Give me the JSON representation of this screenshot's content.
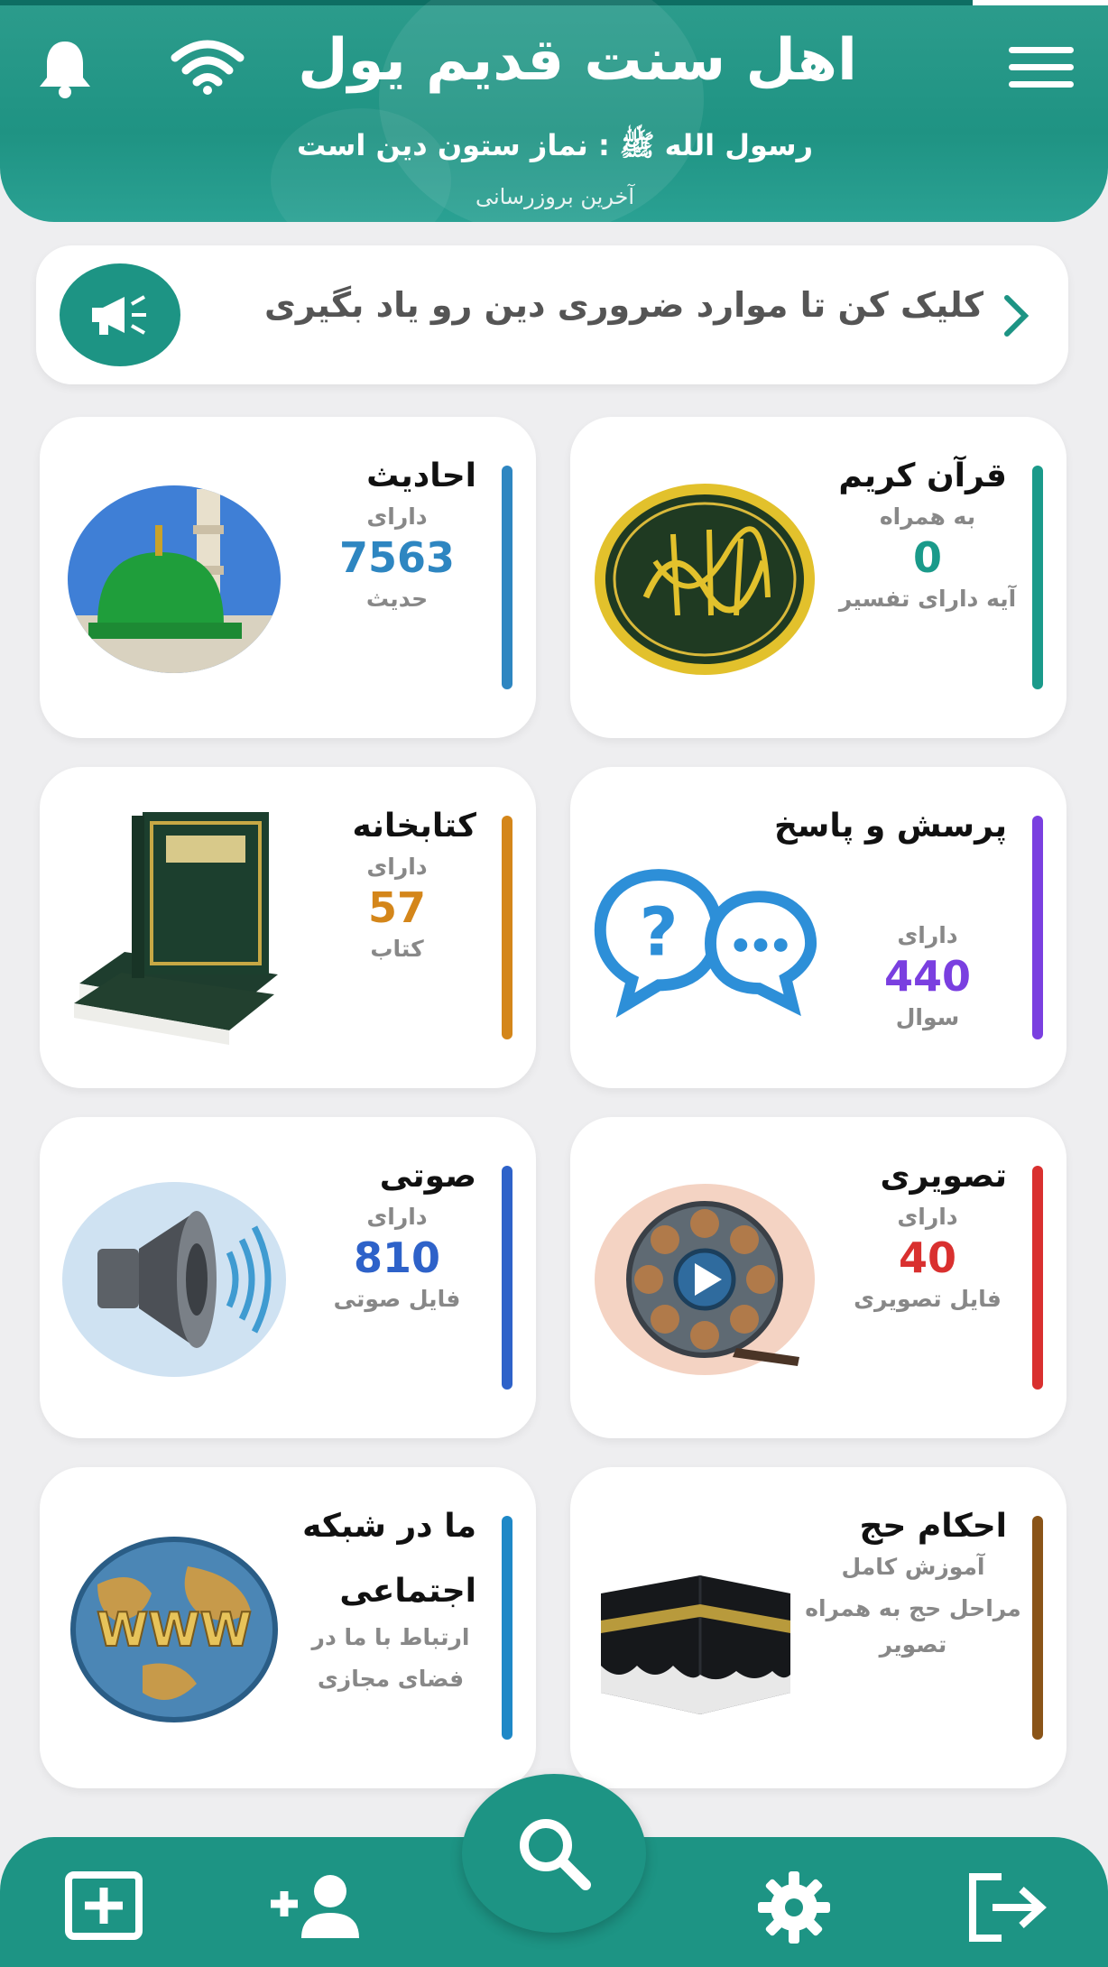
{
  "header": {
    "title": "اهل سنت قدیم یول",
    "subtitle": "رسول الله ﷺ : نماز ستون دین است",
    "update_text": "آخرین بروزرسانی"
  },
  "banner": {
    "text": "کلیک کن تا موارد ضروری دین رو یاد بگیری"
  },
  "cards": {
    "quran": {
      "title": "قرآن کریم",
      "pre": "به همراه",
      "num": "0",
      "post": "آیه دارای تفسیر",
      "color": "#1a9a8a"
    },
    "hadith": {
      "title": "احادیث",
      "pre": "دارای",
      "num": "7563",
      "post": "حدیث",
      "color": "#2e86c1"
    },
    "qa": {
      "title": "پرسش و پاسخ",
      "pre": "دارای",
      "num": "440",
      "post": "سوال",
      "color": "#7a3fe0"
    },
    "library": {
      "title": "کتابخانه",
      "pre": "دارای",
      "num": "57",
      "post": "کتاب",
      "color": "#d4861a"
    },
    "video": {
      "title": "تصویری",
      "pre": "دارای",
      "num": "40",
      "post": "فایل تصویری",
      "color": "#d9302f"
    },
    "audio": {
      "title": "صوتی",
      "pre": "دارای",
      "num": "810",
      "post": "فایل صوتی",
      "color": "#2e62c9"
    },
    "hajj": {
      "title": "احکام حج",
      "pre": "آموزش کامل",
      "post": "مراحل حج به همراه تصویر",
      "color": "#8a5418"
    },
    "social": {
      "title": "ما در شبکه اجتماعی",
      "pre": "ارتباط با ما در فضای مجازی",
      "color": "#1e88c7"
    }
  },
  "images": {
    "www_text": "WWW"
  },
  "colors": {
    "primary": "#1d9484",
    "header": "#2c9c8c"
  }
}
